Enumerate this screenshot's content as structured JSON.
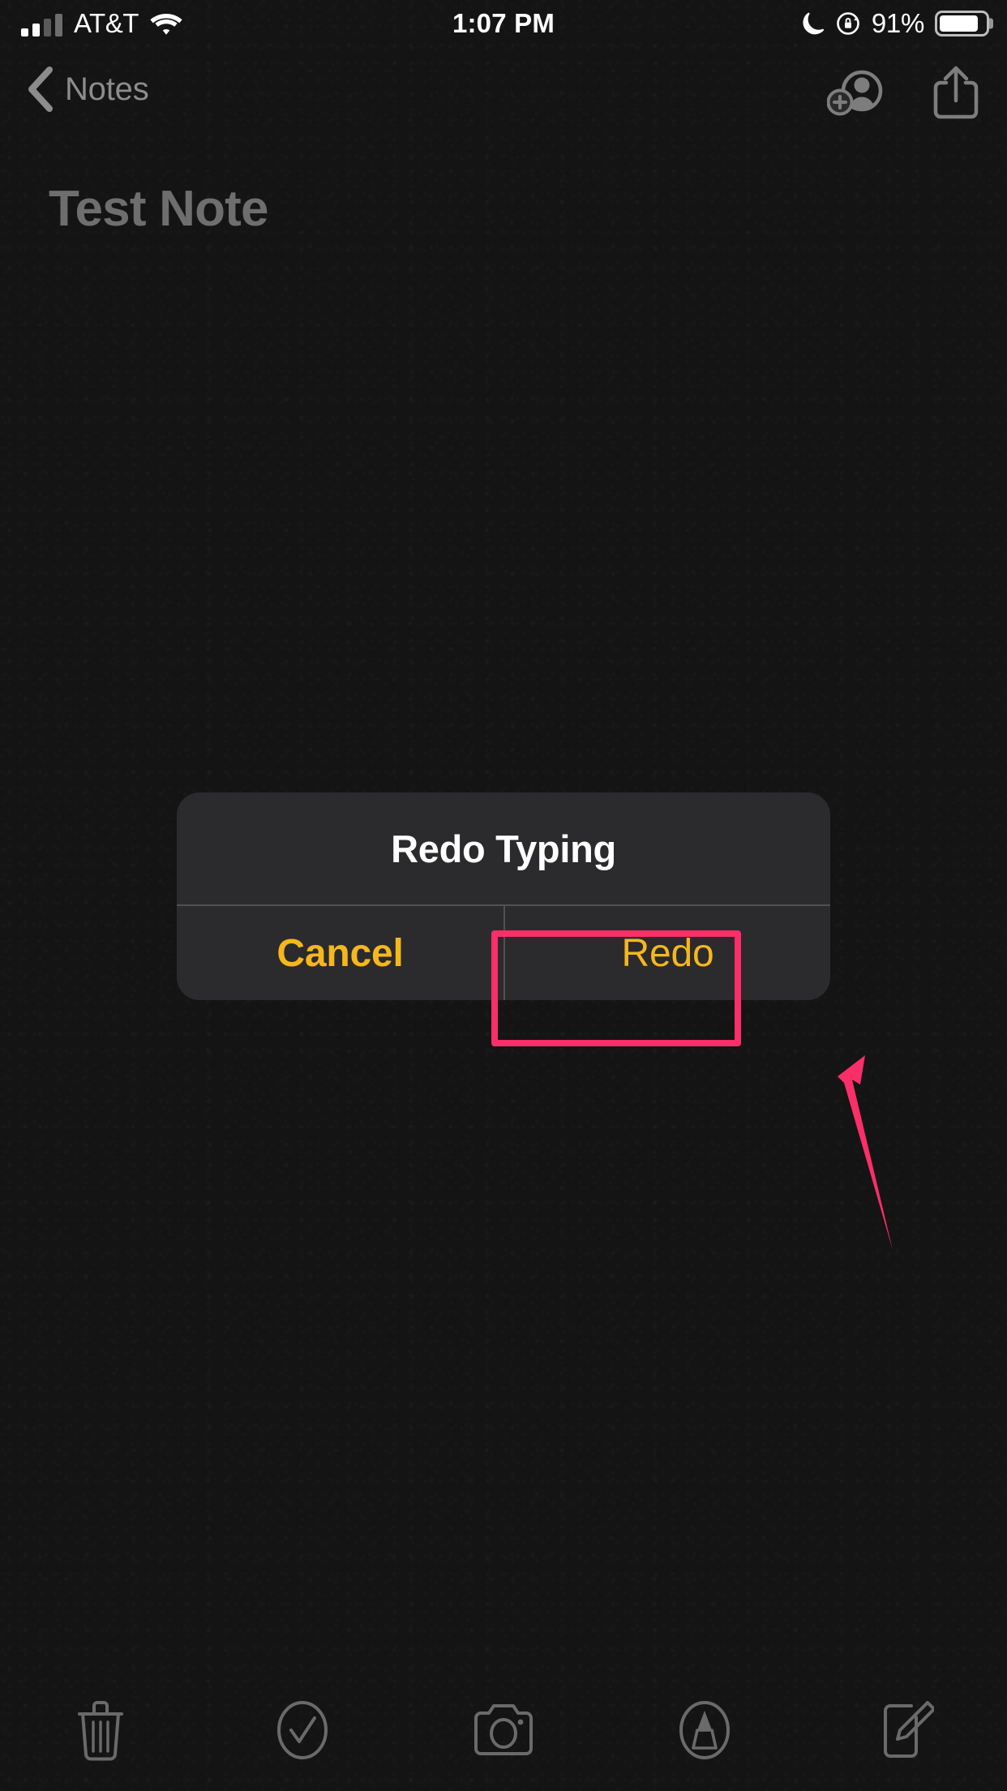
{
  "status_bar": {
    "carrier": "AT&T",
    "signal_bars_filled": 2,
    "signal_bars_total": 4,
    "wifi_icon": "wifi-icon",
    "time": "1:07 PM",
    "do_not_disturb_icon": "moon-icon",
    "rotation_lock_icon": "rotation-lock-icon",
    "battery_percent": "91%",
    "battery_level": 91,
    "battery_icon": "battery-icon"
  },
  "nav_bar": {
    "back_icon": "chevron-left-icon",
    "back_label": "Notes",
    "collaborate_icon": "add-person-icon",
    "share_icon": "share-icon"
  },
  "note": {
    "title": "Test Note",
    "body": ""
  },
  "alert": {
    "title": "Redo Typing",
    "cancel_label": "Cancel",
    "confirm_label": "Redo"
  },
  "annotation": {
    "highlight_color": "#fa2e68",
    "arrow_color": "#fa2e68",
    "target": "Redo"
  },
  "toolbar": {
    "items": [
      {
        "name": "delete-icon",
        "label": "Delete"
      },
      {
        "name": "checklist-icon",
        "label": "Checklist"
      },
      {
        "name": "camera-icon",
        "label": "Camera"
      },
      {
        "name": "markup-icon",
        "label": "Markup"
      },
      {
        "name": "compose-icon",
        "label": "Compose"
      }
    ]
  },
  "colors": {
    "background": "#141414",
    "alert_background": "#2b2b2d",
    "accent_yellow": "#f5b71c",
    "dimmed_text": "#8c8c8c",
    "title_text": "#6e6e6e",
    "annotation_pink": "#fa2e68"
  }
}
